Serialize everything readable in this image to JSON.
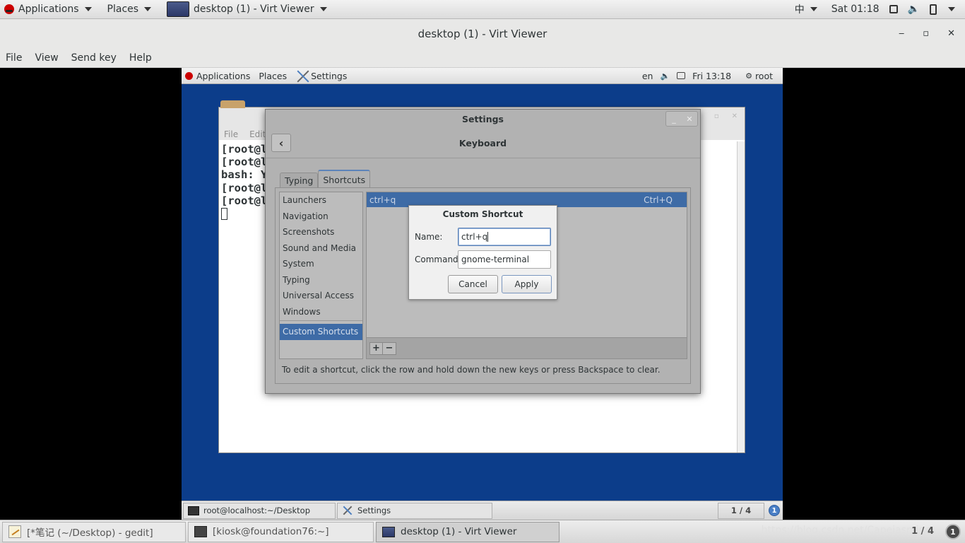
{
  "host_panel": {
    "applications": "Applications",
    "places": "Places",
    "window_task": "desktop (1) - Virt Viewer",
    "input_method": "中",
    "clock": "Sat 01:18"
  },
  "virt_viewer": {
    "title": "desktop (1) - Virt Viewer",
    "menu": [
      "File",
      "View",
      "Send key",
      "Help"
    ],
    "controls": {
      "minimize": "‒",
      "maximize": "▫",
      "close": "✕"
    }
  },
  "guest_panel": {
    "applications": "Applications",
    "places": "Places",
    "settings": "Settings",
    "lang": "en",
    "clock": "Fri 13:18",
    "user": "root"
  },
  "terminal": {
    "menu": [
      "File",
      "Edit"
    ],
    "lines": [
      "[root@l",
      "[root@l",
      "bash: Y",
      "[root@l",
      "[root@l"
    ]
  },
  "settings": {
    "title": "Settings",
    "header": "Keyboard",
    "tabs": [
      "Typing",
      "Shortcuts"
    ],
    "categories": [
      "Launchers",
      "Navigation",
      "Screenshots",
      "Sound and Media",
      "System",
      "Typing",
      "Universal Access",
      "Windows"
    ],
    "selected_category": "Custom Shortcuts",
    "shortcut_row": {
      "name": "ctrl+q",
      "accel": "Ctrl+Q"
    },
    "hint": "To edit a shortcut, click the row and hold down the new keys or press Backspace to clear."
  },
  "dialog": {
    "title": "Custom Shortcut",
    "name_label": "Name:",
    "name_value": "ctrl+q",
    "command_label": "Command:",
    "command_value": "gnome-terminal",
    "cancel": "Cancel",
    "apply": "Apply"
  },
  "guest_bottom": {
    "task_terminal": "root@localhost:~/Desktop",
    "task_settings": "Settings",
    "pager": "1 / 4",
    "info": "1"
  },
  "host_bottom": {
    "task_gedit": "[*笔记 (~/Desktop) - gedit]",
    "task_terminal": "[kiosk@foundation76:~]",
    "task_viewer": "desktop (1) - Virt Viewer",
    "watermark": "https://blog.csdn.net/Capejasmine",
    "pager": "1 / 4",
    "info": "1"
  }
}
